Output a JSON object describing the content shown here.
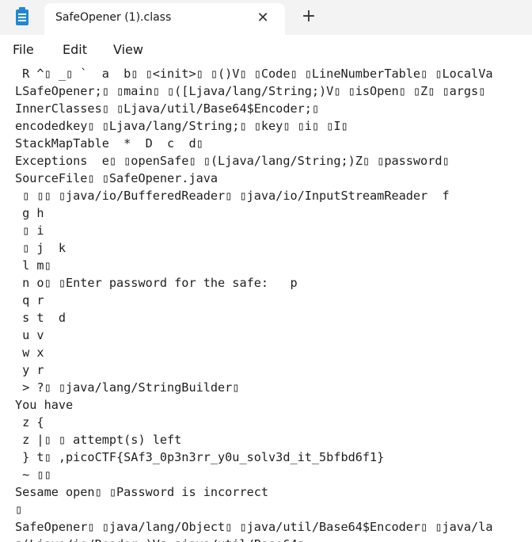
{
  "window": {
    "app_icon": "notepad-icon",
    "tab_title": "SafeOpener (1).class",
    "tab_close_glyph": "✕",
    "new_tab_glyph": "+"
  },
  "menu": {
    "items": [
      "File",
      "Edit",
      "View"
    ]
  },
  "editor": {
    "lines": [
      " R ^▯ _▯ `  a  b▯ ▯<init>▯ ▯()V▯ ▯Code▯ ▯LineNumberTable▯ ▯LocalVa",
      "LSafeOpener;▯ ▯main▯ ▯([Ljava/lang/String;)V▯ ▯isOpen▯ ▯Z▯ ▯args▯",
      "InnerClasses▯ ▯Ljava/util/Base64$Encoder;▯",
      "encodedkey▯ ▯Ljava/lang/String;▯ ▯key▯ ▯i▯ ▯I▯",
      "StackMapTable  *  D  c  d▯",
      "Exceptions  e▯ ▯openSafe▯ ▯(Ljava/lang/String;)Z▯ ▯password▯",
      "SourceFile▯ ▯SafeOpener.java",
      " ▯ ▯▯ ▯java/io/BufferedReader▯ ▯java/io/InputStreamReader  f",
      " g h",
      " ▯ i",
      " ▯ j  k",
      " l m▯",
      " n o▯ ▯Enter password for the safe:   p",
      " q r",
      " s t  d",
      " u v",
      " w x",
      " y r",
      " > ?▯ ▯java/lang/StringBuilder▯",
      "You have",
      " z {",
      " z |▯ ▯ attempt(s) left",
      " } t▯ ,picoCTF{SAf3_0p3n3rr_y0u_solv3d_it_5bfbd6f1}",
      " ~ ▯▯",
      "Sesame open▯ ▯Password is incorrect",
      "▯",
      "SafeOpener▯ ▯java/lang/Object▯ ▯java/util/Base64$Encoder▯ ▯java/la",
      "▯(Ljava/io/Reader;)V▯ ▯java/util/Base64▯"
    ]
  }
}
